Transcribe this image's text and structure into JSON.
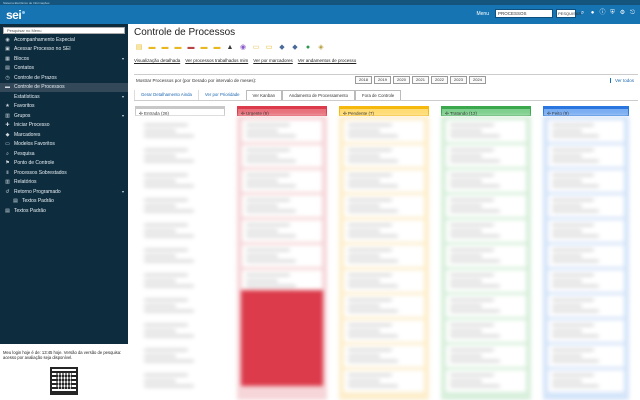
{
  "topstrip": {
    "text": "Sistema Eletrônico de Informações"
  },
  "topbar": {
    "logo": "sei",
    "menu_label": "Menu",
    "unit": "PROCESSOS",
    "search_value": "PESQUISAR",
    "icons": [
      "user-icon",
      "info-icon",
      "shield-icon",
      "gear-icon",
      "logout-icon"
    ]
  },
  "sidebar": {
    "search_placeholder": "Pesquisar no Menu",
    "items": [
      {
        "label": "Acompanhamento Especial",
        "icon": "eye-icon"
      },
      {
        "label": "Acessar Processo no SEI",
        "icon": "door-icon"
      },
      {
        "label": "Blocos",
        "icon": "block-icon",
        "chevron": true
      },
      {
        "label": "Contatos",
        "icon": "contact-icon"
      },
      {
        "label": "Controle de Prazos",
        "icon": "clock-icon"
      },
      {
        "label": "Controle de Processos",
        "icon": "folder-icon",
        "active": true
      },
      {
        "label": "Estatísticas",
        "icon": "",
        "chevron": true
      },
      {
        "label": "Favoritos",
        "icon": "star-icon"
      },
      {
        "label": "Grupos",
        "icon": "group-icon",
        "chevron": true
      },
      {
        "label": "Iniciar Processo",
        "icon": "plus-icon"
      },
      {
        "label": "Marcadores",
        "icon": "tag-icon"
      },
      {
        "label": "Modelos Favoritos",
        "icon": "doc-icon"
      },
      {
        "label": "Pesquisa",
        "icon": "search-icon"
      },
      {
        "label": "Ponto de Controle",
        "icon": "flag-icon"
      },
      {
        "label": "Processos Sobrestados",
        "icon": "pause-icon"
      },
      {
        "label": "Relatórios",
        "icon": "chart-icon"
      },
      {
        "label": "Retorno Programado",
        "icon": "return-icon",
        "chevron": true
      },
      {
        "label": "Textos Padrão",
        "icon": "text-icon",
        "sub": true
      },
      {
        "label": "Textos Padrão",
        "icon": "text-icon"
      }
    ],
    "footer_text": "Meu login hoje é de: 13:45 hoje. Versão da versão de pesquisa: acesso por avaliação seja disponível."
  },
  "main": {
    "title": "Controle de Processos",
    "toolbar_icons": [
      {
        "name": "new-process-icon",
        "color": "#e8b820",
        "glyph": "▤"
      },
      {
        "name": "folder-icon",
        "color": "#e8b820",
        "glyph": "▬"
      },
      {
        "name": "folder-open-icon",
        "color": "#e8b820",
        "glyph": "▬"
      },
      {
        "name": "send-icon",
        "color": "#e8b820",
        "glyph": "▬"
      },
      {
        "name": "assign-icon",
        "color": "#b84444",
        "glyph": "▬"
      },
      {
        "name": "folder-red-icon",
        "color": "#e8b820",
        "glyph": "▬"
      },
      {
        "name": "folder-check-icon",
        "color": "#e8b820",
        "glyph": "▬"
      },
      {
        "name": "lock-icon",
        "color": "#3a3a3a",
        "glyph": "▲"
      },
      {
        "name": "eye-icon",
        "color": "#8a5ac8",
        "glyph": "◉"
      },
      {
        "name": "note-icon",
        "color": "#e8c050",
        "glyph": "▭"
      },
      {
        "name": "document-icon",
        "color": "#e8b820",
        "glyph": "▭"
      },
      {
        "name": "bird-icon",
        "color": "#4a6a9a",
        "glyph": "◆"
      },
      {
        "name": "flag-icon",
        "color": "#4a6a9a",
        "glyph": "◆"
      },
      {
        "name": "clock-icon",
        "color": "#2a9a4a",
        "glyph": "●"
      },
      {
        "name": "badge-icon",
        "color": "#b8a040",
        "glyph": "◈"
      }
    ],
    "links": [
      "Visualização detalhada",
      "Ver processos trabalhados mim",
      "Ver por marcadores",
      "Ver andamentos de processo"
    ],
    "filter_text": "Mostrar Processos por (por Gerado por intervalo de meses):",
    "years": [
      "2018",
      "2019",
      "2020",
      "2021",
      "2022",
      "2023",
      "2024"
    ],
    "right_link": "Ver todos",
    "tabs": [
      {
        "label": "Gerar Detalhamento Ainda",
        "on": false
      },
      {
        "label": "Ver por Prioridade",
        "on": false
      },
      {
        "label": "Ver Kanban",
        "on": true
      },
      {
        "label": "Andamento de Processamento",
        "on": true
      },
      {
        "label": "Fora de Controle",
        "on": true
      }
    ],
    "columns": [
      {
        "title": "Entrada (26)",
        "color": "#ffffff",
        "border": "#c8c8c8",
        "bg": "#ffffff"
      },
      {
        "title": "Urgente (6)",
        "color": "#e8717c",
        "border": "#dc3b4b",
        "bg": "#f6d6d9"
      },
      {
        "title": "Pendente (7)",
        "color": "#ffdc73",
        "border": "#f4b90c",
        "bg": "#fdeecb"
      },
      {
        "title": "Tratando (12)",
        "color": "#7fd08e",
        "border": "#3ba84e",
        "bg": "#d7efdb"
      },
      {
        "title": "Feito (9)",
        "color": "#7aaef2",
        "border": "#2a76e0",
        "bg": "#d4e4f9"
      }
    ]
  }
}
